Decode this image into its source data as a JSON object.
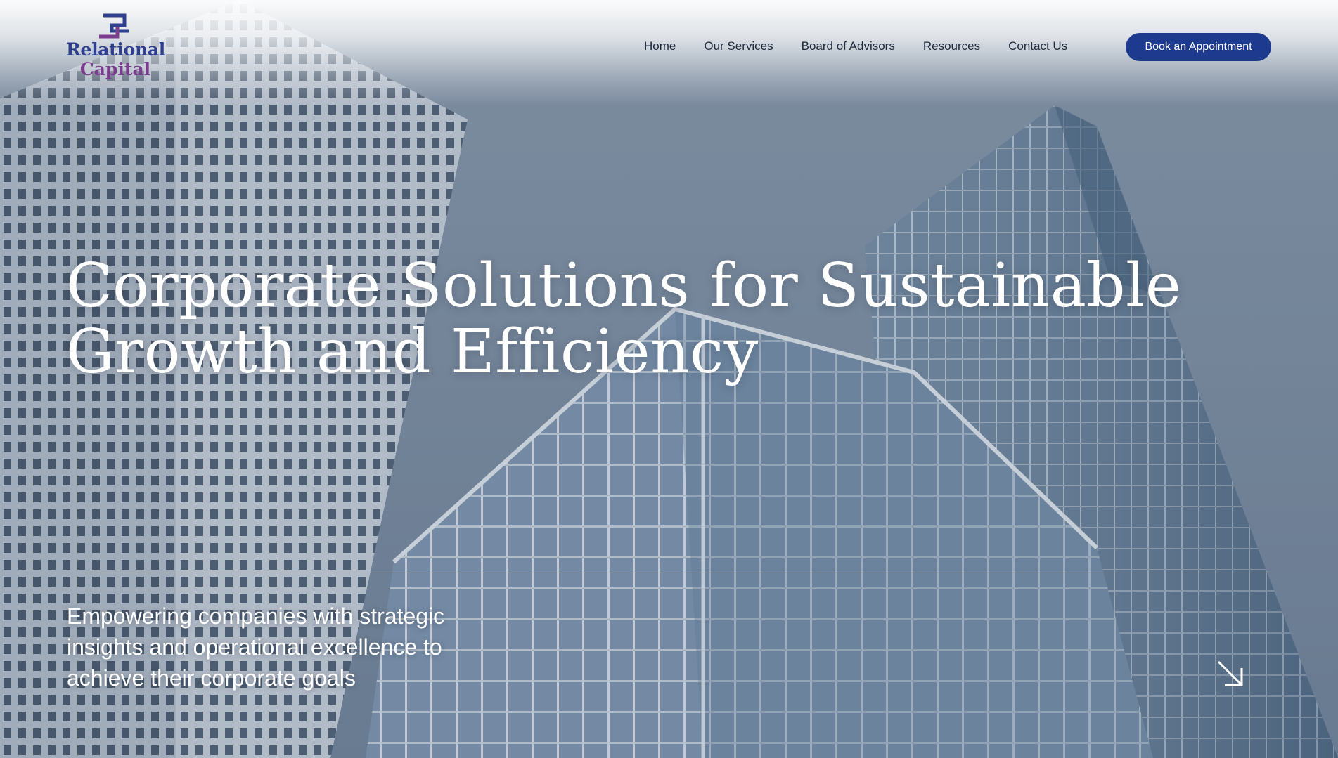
{
  "brand": {
    "logo_line1": "Relational",
    "logo_line2": "Capital",
    "logo_color_primary": "#2e3f8f",
    "logo_color_secondary": "#7a3c8c"
  },
  "nav": {
    "items": [
      {
        "label": "Home"
      },
      {
        "label": "Our Services"
      },
      {
        "label": "Board of Advisors"
      },
      {
        "label": "Resources"
      },
      {
        "label": "Contact Us"
      }
    ],
    "cta_label": "Book an Appointment",
    "cta_color": "#1e3a8e"
  },
  "hero": {
    "headline_line1": "Corporate Solutions for Sustainable",
    "headline_line2": "Growth and Efficiency",
    "subtext_line1": "Empowering companies with strategic",
    "subtext_line2": "insights and operational excellence to",
    "subtext_line3": "achieve their corporate goals",
    "scroll_icon": "arrow-down-right-icon",
    "background": "skyscrapers-photo"
  }
}
